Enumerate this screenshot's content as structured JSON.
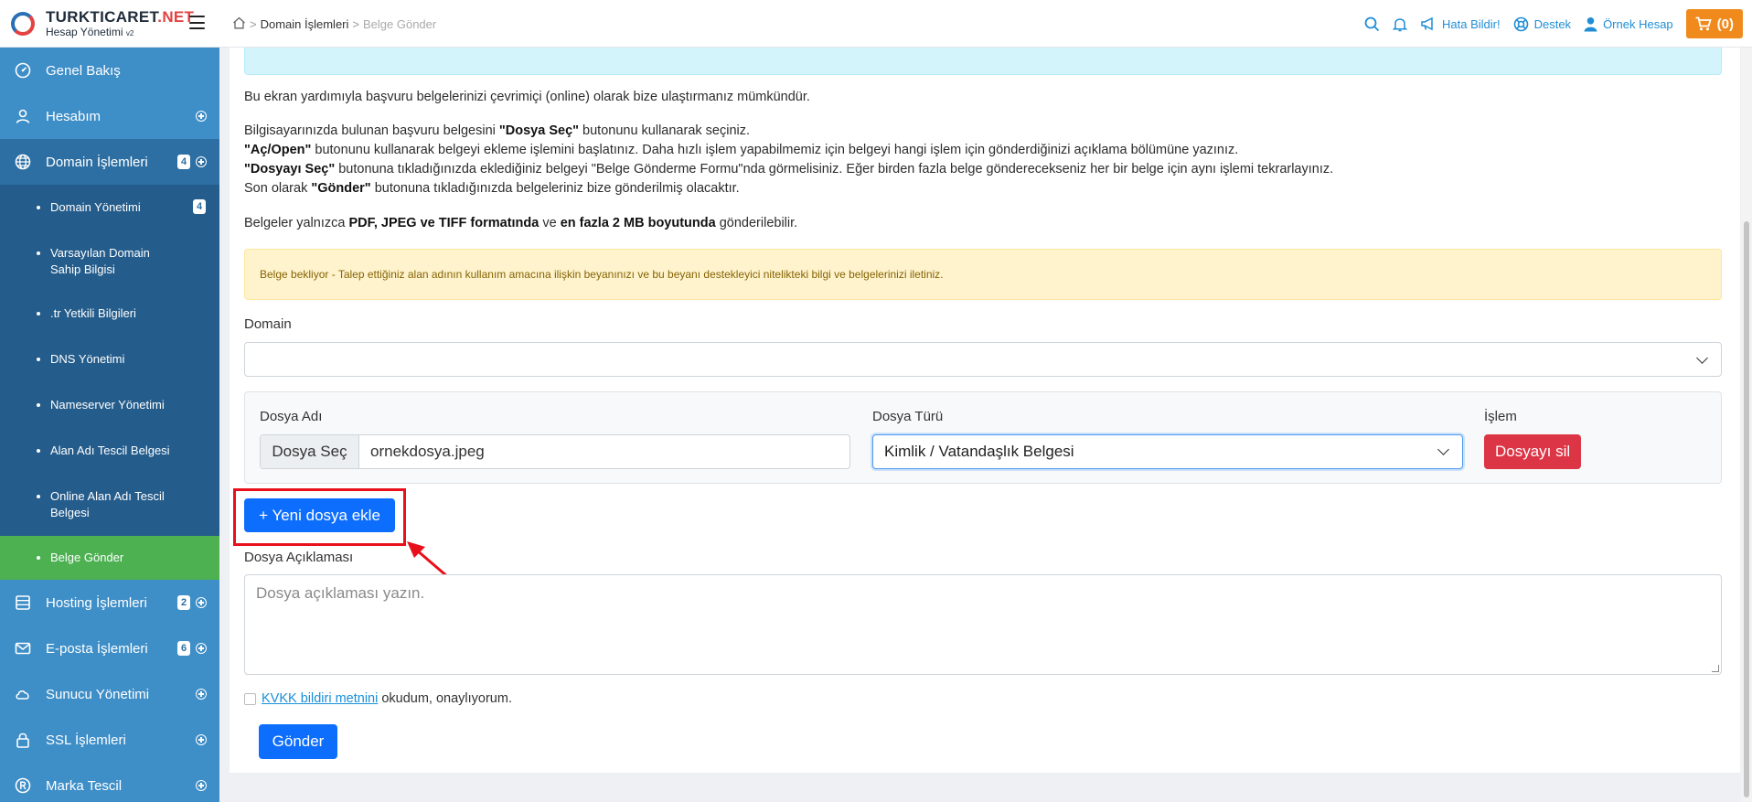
{
  "brand": {
    "name_main": "TURKTICARET",
    "name_tld": ".NET",
    "subtitle": "Hesap Yönetimi",
    "version": "v2"
  },
  "sidebar": {
    "items": [
      {
        "label": "Genel Bakış",
        "icon": "gauge-icon"
      },
      {
        "label": "Hesabım",
        "icon": "user-icon"
      },
      {
        "label": "Domain İşlemleri",
        "icon": "globe-icon",
        "badge": "4"
      },
      {
        "label": "Hosting İşlemleri",
        "icon": "server-icon",
        "badge": "2"
      },
      {
        "label": "E-posta İşlemleri",
        "icon": "mail-icon",
        "badge": "6"
      },
      {
        "label": "Sunucu Yönetimi",
        "icon": "cloud-icon"
      },
      {
        "label": "SSL İşlemleri",
        "icon": "lock-icon"
      },
      {
        "label": "Marka Tescil",
        "icon": "registered-icon"
      }
    ],
    "domain_submenu": [
      {
        "label": "Domain Yönetimi",
        "badge": "4"
      },
      {
        "label": "Varsayılan Domain",
        "label2": "Sahip Bilgisi"
      },
      {
        "label": ".tr Yetkili Bilgileri"
      },
      {
        "label": "DNS Yönetimi"
      },
      {
        "label": "Nameserver Yönetimi"
      },
      {
        "label": "Alan Adı Tescil Belgesi"
      },
      {
        "label": "Online Alan Adı Tescil",
        "label2": "Belgesi"
      },
      {
        "label": "Belge Gönder"
      }
    ]
  },
  "breadcrumb": {
    "parent": "Domain İşlemleri",
    "current": "Belge Gönder"
  },
  "topbar": {
    "report_bug": "Hata Bildir!",
    "support": "Destek",
    "account": "Örnek Hesap",
    "cart": "(0)"
  },
  "content": {
    "intro": "Bu ekran yardımıyla başvuru belgelerinizi çevrimiçi (online) olarak bize ulaştırmanız mümkündür.",
    "step1_a": "Bilgisayarınızda bulunan başvuru belgesini ",
    "step1_b": "\"Dosya Seç\"",
    "step1_c": " butonunu kullanarak seçiniz.",
    "step2_a": "\"Aç/Open\"",
    "step2_b": " butonunu kullanarak belgeyi ekleme işlemini başlatınız. Daha hızlı işlem yapabilmemiz için belgeyi hangi işlem için gönderdiğinizi açıklama bölümüne yazınız.",
    "step3_a": "\"Dosyayı Seç\"",
    "step3_b": " butonuna tıkladığınızda eklediğiniz belgeyi \"Belge Gönderme Formu\"nda görmelisiniz. Eğer birden fazla belge gönderecekseniz her bir belge için aynı işlemi tekrarlayınız.",
    "step4_a": "Son olarak ",
    "step4_b": "\"Gönder\"",
    "step4_c": " butonuna tıkladığınızda belgeleriniz bize gönderilmiş olacaktır.",
    "format_a": "Belgeler yalnızca ",
    "format_b": "PDF, JPEG ve TIFF formatında",
    "format_c": " ve ",
    "format_d": "en fazla 2 MB boyutunda",
    "format_e": " gönderilebilir.",
    "warning": "Belge bekliyor - Talep ettiğiniz alan adının kullanım amacına ilişkin beyanınızı ve bu beyanı destekleyici nitelikteki bilgi ve belgelerinizi iletiniz.",
    "domain_label": "Domain",
    "domain_value": ""
  },
  "file_row": {
    "file_name_label": "Dosya Adı",
    "choose_button": "Dosya Seç",
    "file_name": "ornekdosya.jpeg",
    "file_type_label": "Dosya Türü",
    "file_type_value": "Kimlik / Vatandaşlık Belgesi",
    "action_label": "İşlem",
    "delete_button": "Dosyayı sil"
  },
  "add_file_button": "+ Yeni dosya ekle",
  "description": {
    "label": "Dosya Açıklaması",
    "placeholder": "Dosya açıklaması yazın."
  },
  "kvkk": {
    "link": "KVKK bildiri metnini",
    "text": "okudum, onaylıyorum."
  },
  "submit_button": "Gönder",
  "colors": {
    "sidebar": "#3e8ec7",
    "sidebar_active": "#2d6fa3",
    "submenu_active": "#4db152",
    "primary": "#0d6efd",
    "danger": "#dc3545",
    "cart": "#f08a1c",
    "highlight": "#e8101a"
  }
}
